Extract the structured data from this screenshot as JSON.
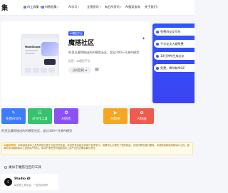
{
  "header": {
    "logo": "集",
    "nav": [
      {
        "label": "AI工具集",
        "chevron": "▾"
      },
      {
        "label": "AI教程集",
        "chevron": "▾"
      },
      {
        "label": "AI学习",
        "chevron": "▾"
      },
      {
        "label": "全景资讯",
        "chevron": "▾"
      },
      {
        "label": "每日AI资讯",
        "chevron": "▾"
      },
      {
        "label": "AI备案查询",
        "chevron": ""
      },
      {
        "label": "关于我们",
        "chevron": "▾"
      }
    ]
  },
  "main": {
    "badge": "AI模型平台",
    "title": "魔搭社区",
    "description": "阿里达摩院推出的AI模型社区，超过300+开源AI模型",
    "tags": "标签：AI模型平台",
    "visit_label": "访问官网",
    "visit_arrow": "➔",
    "qr_icon": "▦",
    "ad_mark": "✦",
    "preview": {
      "heading": "ModelScope"
    }
  },
  "right_panel": {
    "items": [
      "免费AI论文写作",
      "千字论文大纲免费",
      "10分钟AI生成论文",
      "免费，降AI和AIGC"
    ]
  },
  "actions": [
    {
      "label": "免费AI写作",
      "icon": "✎"
    },
    {
      "label": "AI写作工具",
      "icon": "☷"
    },
    {
      "label": "AI创作",
      "icon": "✪"
    },
    {
      "label": "AI影视",
      "icon": "▶"
    },
    {
      "label": "AI绘画",
      "icon": "✿"
    }
  ],
  "summary": "阿里达摩院推出的AI模型社区，超过300+开源AI模型",
  "notice": {
    "label": "AI版权声明：",
    "text": "本网站收录AI工具所有权归属于对应的开发者，本站所有内容仅供用户参考学习，如果您认为侵犯了您的权益，请及时联系我们删除，请谨慎选择使用网站AI工具，使用前请详细阅读AI工具的用户协议，本站不承担任何因使用AI工具产生的法律后果与责任。"
  },
  "related": {
    "title": "类似于魔搭社区的工具",
    "card": {
      "icon_text": "S",
      "name": "Studio AI",
      "desc": "AI创意工具平台，一站式AI创作"
    }
  },
  "colors": {
    "brand_blue": "#3b5bff",
    "tile_blue": "#3d7bff",
    "tile_green": "#37c26d",
    "tile_purple": "#8a52f4",
    "tile_orange": "#f5a623",
    "tile_red": "#ef5b4d"
  }
}
